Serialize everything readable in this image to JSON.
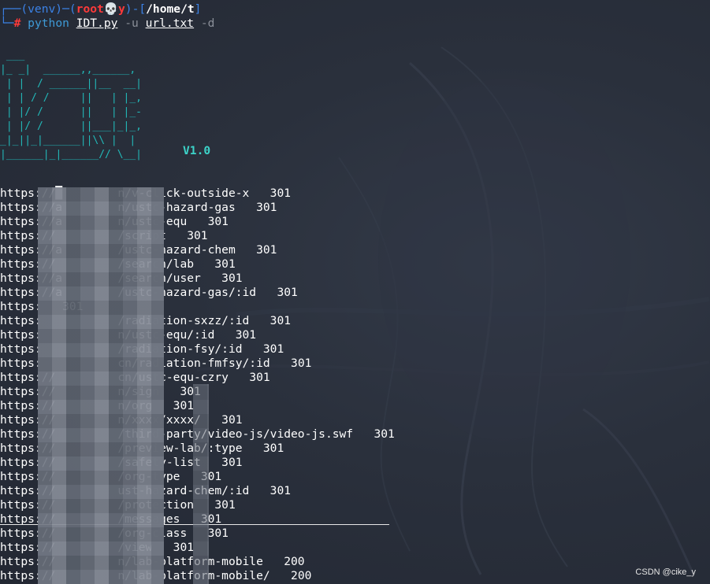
{
  "terminal": {
    "prompt": {
      "venv": "(venv)",
      "user": "root",
      "skull": "💀",
      "host": "y",
      "path": "/home/t",
      "symbol": "#"
    },
    "command": {
      "program": "python",
      "script": "IDT.py",
      "flag_u": "-u",
      "url_file": "url.txt",
      "flag_d": "-d"
    },
    "banner_art": " ___        \n|_ _|  ______,,______,\n | |  / ______||__  __|\n | | / /     ||   | |_,\n | |/ /      ||   | |_-\n | |/ /      ||___|_|_,\n_|_||_|______||\\\\ |  |\n|______|_|______// \\__|",
    "version": "V1.0"
  },
  "results": [
    {
      "url": "https://█        n/v-click-outside-x",
      "code": "301"
    },
    {
      "url": "https://a        n/ustc-hazard-gas",
      "code": "301"
    },
    {
      "url": "https://a        n/ustc-equ",
      "code": "301"
    },
    {
      "url": "https://         /script",
      "code": "301"
    },
    {
      "url": "https://a        /ustc-hazard-chem",
      "code": "301"
    },
    {
      "url": "https://         /search/lab",
      "code": "301"
    },
    {
      "url": "https://a        /search/user",
      "code": "301"
    },
    {
      "url": "https://a        /ustc-hazard-gas/:id",
      "code": "301"
    },
    {
      "url": "https:",
      "code": "301"
    },
    {
      "url": "https:           /radiation-sxzz/:id",
      "code": "301"
    },
    {
      "url": "https:           n/ustc-equ/:id",
      "code": "301"
    },
    {
      "url": "https:           /radiation-fsy/:id",
      "code": "301"
    },
    {
      "url": "https:           cn/radiation-fmfsy/:id",
      "code": "301"
    },
    {
      "url": "https://         cn/ustc-equ-czry",
      "code": "301"
    },
    {
      "url": "https://         n/sign",
      "code": "301"
    },
    {
      "url": "https://         n/org",
      "code": "301"
    },
    {
      "url": "https://         n/xxxx/xxxx/",
      "code": "301"
    },
    {
      "url": "https://         /third-party/video-js/video-js.swf",
      "code": "301"
    },
    {
      "url": "https://         /preview-lab/:type",
      "code": "301"
    },
    {
      "url": "https://         /safety-list",
      "code": "301"
    },
    {
      "url": "https://         /org-type",
      "code": "301"
    },
    {
      "url": "https://         ust-hazard-chem/:id",
      "code": "301"
    },
    {
      "url": "https://         /protection",
      "code": "301"
    },
    {
      "url": "https://         /messages",
      "code": "301"
    },
    {
      "url": "https://         /org-class",
      "code": "301"
    },
    {
      "url": "https://         /view",
      "code": "301"
    },
    {
      "url": "https://         n/lab-platform-mobile",
      "code": "200"
    },
    {
      "url": "https://         n/lab-platform-mobile/",
      "code": "200"
    }
  ],
  "watermark": "CSDN @cike_y",
  "colors": {
    "background": "#262b36",
    "prompt_blue": "#3b82e6",
    "root_red": "#ff3a3a",
    "banner_cyan": "#22b8b8",
    "text": "#ffffff"
  }
}
